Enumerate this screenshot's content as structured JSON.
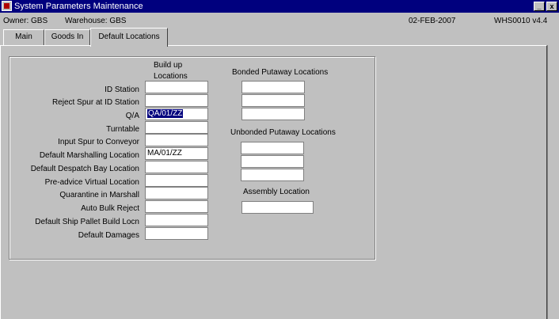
{
  "window": {
    "title": "System Parameters Maintenance",
    "minimize_glyph": "_",
    "close_glyph": "x"
  },
  "info": {
    "owner": "Owner: GBS",
    "warehouse": "Warehouse: GBS",
    "date": "02-FEB-2007",
    "version": "WHS0010 v4.4"
  },
  "tabs": [
    {
      "label": "Main"
    },
    {
      "label": "Goods In"
    },
    {
      "label": "Default Locations"
    }
  ],
  "buildup": {
    "header_line1": "Build up",
    "header_line2": "Locations",
    "rows": [
      {
        "label": "ID Station",
        "value": ""
      },
      {
        "label": "Reject Spur at ID Station",
        "value": ""
      },
      {
        "label": "Q/A",
        "value": "QA/01/ZZ"
      },
      {
        "label": "Turntable",
        "value": ""
      },
      {
        "label": "Input Spur to Conveyor",
        "value": ""
      },
      {
        "label": "Default Marshalling Location",
        "value": "MA/01/ZZ"
      },
      {
        "label": "Default Despatch Bay Location",
        "value": ""
      },
      {
        "label": "Pre-advice Virtual Location",
        "value": ""
      },
      {
        "label": "Quarantine in Marshall",
        "value": ""
      },
      {
        "label": "Auto Bulk Reject",
        "value": ""
      },
      {
        "label": "Default Ship Pallet Build Locn",
        "value": ""
      },
      {
        "label": "Default Damages",
        "value": ""
      }
    ]
  },
  "bonded": {
    "header": "Bonded Putaway Locations",
    "values": [
      "",
      "",
      ""
    ]
  },
  "unbonded": {
    "header": "Unbonded Putaway Locations",
    "values": [
      "",
      "",
      ""
    ]
  },
  "assembly": {
    "header": "Assembly Location",
    "value": ""
  }
}
